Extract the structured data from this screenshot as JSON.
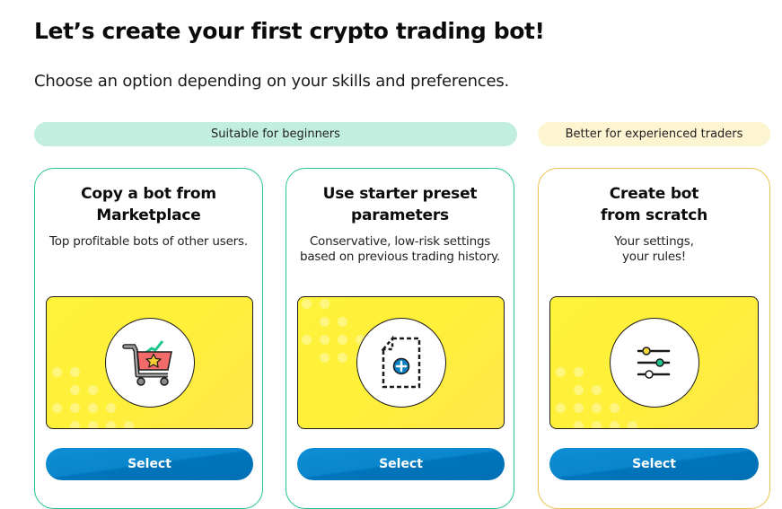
{
  "header": {
    "title": "Let’s create your first crypto trading bot!",
    "subtitle": "Choose an option depending on your skills and preferences."
  },
  "categories": {
    "beginners": {
      "label": "Suitable for beginners",
      "color": "#c2eedf"
    },
    "experienced": {
      "label": "Better for experienced traders",
      "color": "#fdf4d2"
    }
  },
  "cards": [
    {
      "title_line1": "Copy a bot from",
      "title_line2": "Marketplace",
      "desc_line1": "Top profitable bots of other users.",
      "desc_line2": "",
      "icon": "shopping-cart-icon",
      "button_label": "Select",
      "border_color": "#22c393"
    },
    {
      "title_line1": "Use starter preset",
      "title_line2": "parameters",
      "desc_line1": "Conservative, low-risk settings",
      "desc_line2": "based on previous trading history.",
      "icon": "new-document-icon",
      "button_label": "Select",
      "border_color": "#22c393"
    },
    {
      "title_line1": "Create bot",
      "title_line2": "from scratch",
      "desc_line1": "Your settings,",
      "desc_line2": "your rules!",
      "icon": "sliders-icon",
      "button_label": "Select",
      "border_color": "#ecc14e"
    }
  ],
  "colors": {
    "button": "#0a86cc",
    "illustration_bg": "#fff03a",
    "accent_green": "#22c393"
  }
}
